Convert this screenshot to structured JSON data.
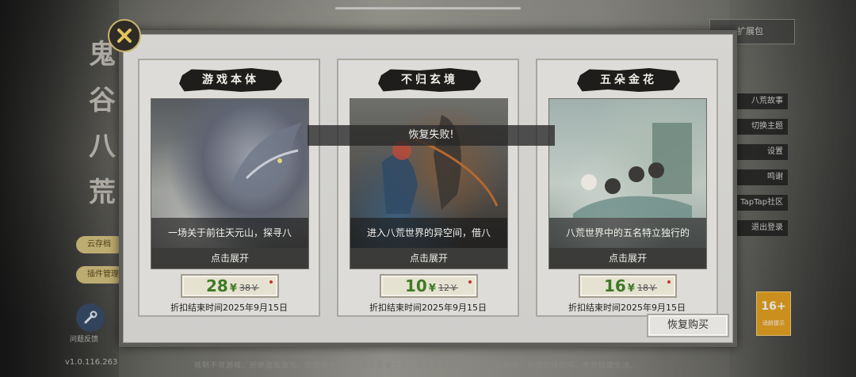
{
  "background": {
    "title_chars": [
      "鬼",
      "谷",
      "八",
      "荒"
    ],
    "pill_1": "云存档",
    "pill_2": "插件管理",
    "tool_label": "问题反馈",
    "version": "v1.0.116.263",
    "footer": "抵制不良游戏，拒绝盗版游戏。注意自我保护，谨防受骗上当。适度游戏益脑，沉迷游戏伤身。合理安排时间，享受健康生活。",
    "top_right_label": "扩展包",
    "menu_items": [
      "八荒故事",
      "切换主题",
      "设置",
      "鸣谢",
      "TapTap社区",
      "退出登录"
    ],
    "age_rating": "16+",
    "age_rating_sub": "适龄提示"
  },
  "modal": {
    "cards": [
      {
        "title": "游戏本体",
        "description": "一场关于前往天元山，探寻八",
        "expand_label": "点击展开",
        "price": "28",
        "currency": "¥",
        "original_price": "38￥",
        "discount_end": "折扣结束时间2025年9月15日"
      },
      {
        "title": "不归玄境",
        "description": "进入八荒世界的异空间，借八",
        "expand_label": "点击展开",
        "price": "10",
        "currency": "¥",
        "original_price": "12￥",
        "discount_end": "折扣结束时间2025年9月15日"
      },
      {
        "title": "五朵金花",
        "description": "八荒世界中的五名特立独行的",
        "expand_label": "点击展开",
        "price": "16",
        "currency": "¥",
        "original_price": "18￥",
        "discount_end": "折扣结束时间2025年9月15日"
      }
    ],
    "restore_label": "恢复购买",
    "toast": "恢复失败!",
    "close_icon": "close-icon"
  },
  "colors": {
    "price_green": "#3e7a26",
    "modal_bg": "#d6d5d2",
    "accent_gold": "#c9b46b"
  }
}
